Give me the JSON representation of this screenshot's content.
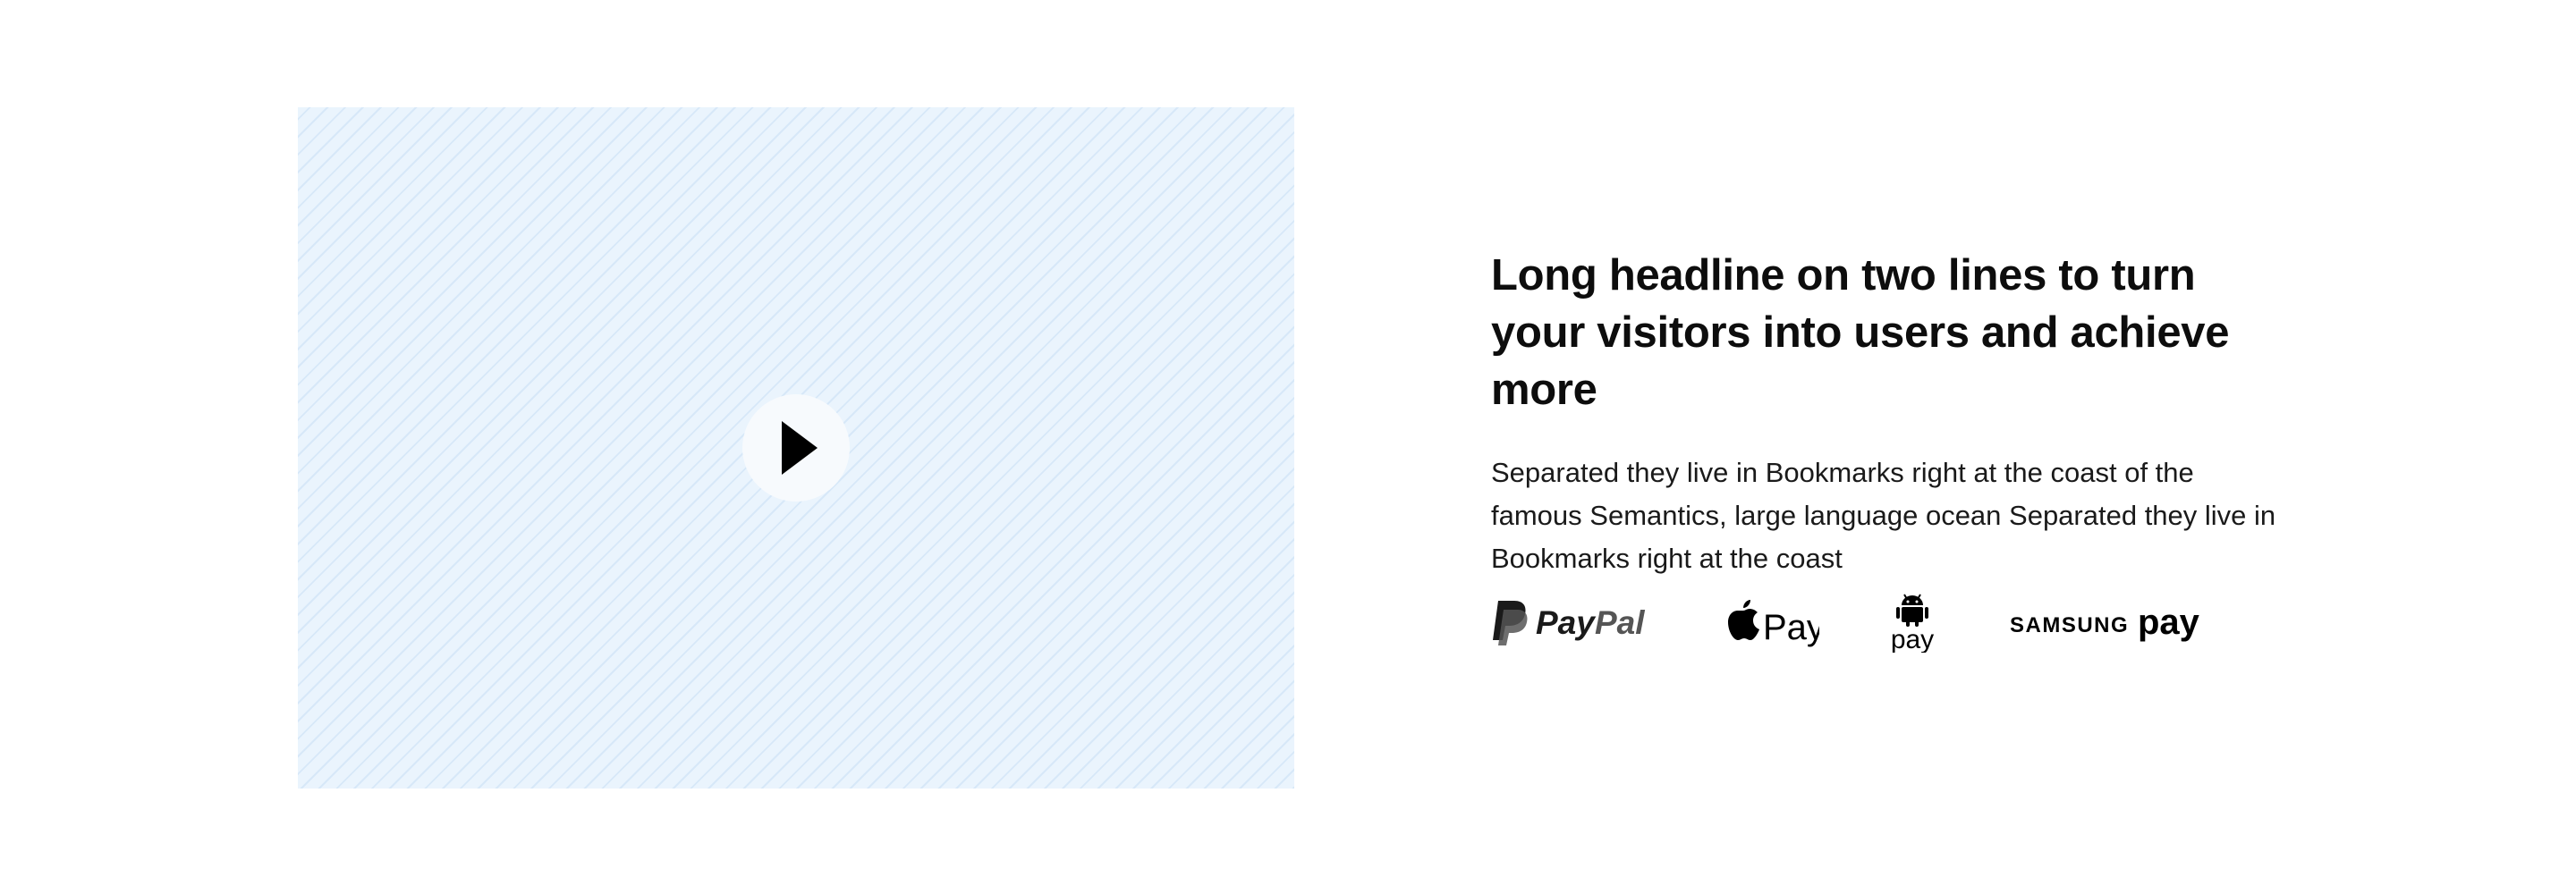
{
  "hero": {
    "headline": "Long headline on two lines to turn your visitors into users and achieve more",
    "description": "Separated they live in Bookmarks right at the coast of the famous Semantics, large language ocean Separated they live in Bookmarks right at the coast",
    "video": {
      "play_icon": "play-icon",
      "placeholder_color": "#eaf4fd"
    }
  },
  "payment_methods": [
    {
      "name": "PayPal",
      "icon": "paypal-logo"
    },
    {
      "name": "Apple Pay",
      "icon": "apple-pay-logo"
    },
    {
      "name": "Android Pay",
      "icon": "android-pay-logo"
    },
    {
      "name": "Samsung Pay",
      "icon": "samsung-pay-logo"
    }
  ],
  "colors": {
    "text": "#0d0d0d",
    "media_bg": "#eaf4fd",
    "paypal_dark": "#1a1a1a",
    "paypal_light": "#555555"
  }
}
